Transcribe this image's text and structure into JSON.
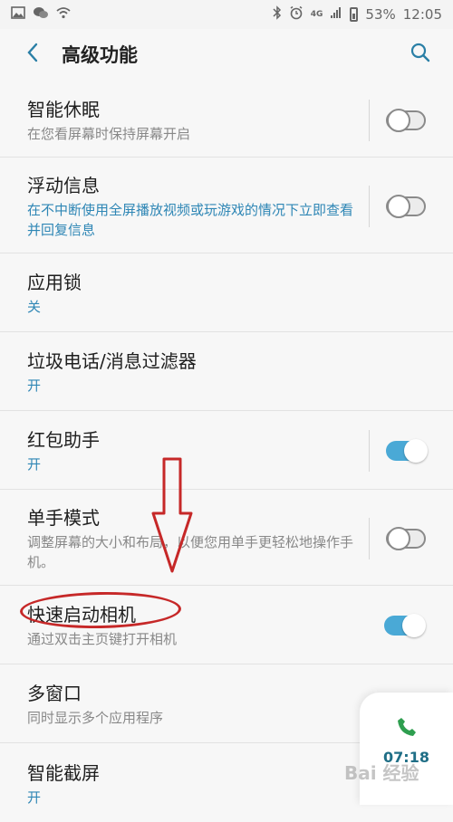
{
  "status_bar": {
    "network": "4G",
    "battery": "53%",
    "time": "12:05",
    "icons": [
      "image-icon",
      "wechat-icon",
      "wifi-icon",
      "bluetooth-icon",
      "alarm-icon",
      "signal-icon",
      "battery-icon"
    ]
  },
  "header": {
    "title": "高级功能",
    "back_icon": "back-icon",
    "search_icon": "search-icon"
  },
  "accent_color": "#2e86b5",
  "toggle_on_color": "#4aa9d6",
  "annotation_color": "#c62828",
  "settings": [
    {
      "title": "智能休眠",
      "subtitle": "在您看屏幕时保持屏幕开启",
      "subtitle_style": "muted",
      "toggle": "off"
    },
    {
      "title": "浮动信息",
      "subtitle": "在不中断使用全屏播放视频或玩游戏的情况下立即查看并回复信息",
      "subtitle_style": "accent",
      "toggle": "off"
    },
    {
      "title": "应用锁",
      "subtitle": "关",
      "subtitle_style": "accent",
      "toggle": null
    },
    {
      "title": "垃圾电话/消息过滤器",
      "subtitle": "开",
      "subtitle_style": "accent",
      "toggle": null
    },
    {
      "title": "红包助手",
      "subtitle": "开",
      "subtitle_style": "accent",
      "toggle": "on"
    },
    {
      "title": "单手模式",
      "subtitle": "调整屏幕的大小和布局，以便您用单手更轻松地操作手机。",
      "subtitle_style": "muted",
      "toggle": "off"
    },
    {
      "title": "快速启动相机",
      "subtitle": "通过双击主页键打开相机",
      "subtitle_style": "muted",
      "toggle": "on"
    },
    {
      "title": "多窗口",
      "subtitle": "同时显示多个应用程序",
      "subtitle_style": "muted",
      "toggle": null
    },
    {
      "title": "智能截屏",
      "subtitle": "开",
      "subtitle_style": "accent",
      "toggle": null
    }
  ],
  "call_widget": {
    "icon": "phone-icon",
    "time": "07:18"
  },
  "watermark": "Bai 经验"
}
